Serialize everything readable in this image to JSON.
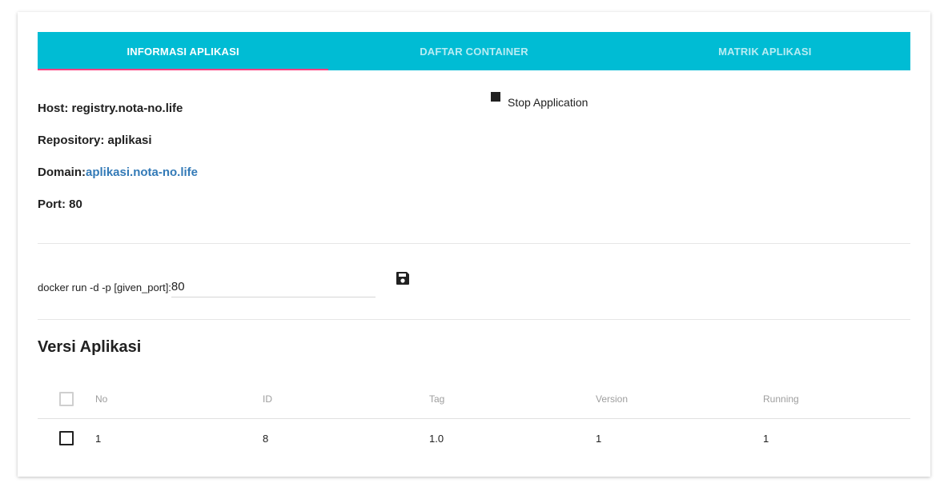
{
  "tabs": [
    {
      "label": "INFORMASI APLIKASI",
      "active": true
    },
    {
      "label": "DAFTAR CONTAINER",
      "active": false
    },
    {
      "label": "MATRIK APLIKASI",
      "active": false
    }
  ],
  "info": {
    "host": "Host: registry.nota-no.life",
    "repository": "Repository: aplikasi",
    "domain_label": "Domain:",
    "domain_link": "aplikasi.nota-no.life",
    "port": "Port: 80"
  },
  "actions": {
    "stop_label": "Stop Application"
  },
  "command": {
    "label": "docker run -d -p [given_port]:",
    "value": "80",
    "save_icon": "floppy-disk-icon"
  },
  "versions": {
    "title": "Versi Aplikasi",
    "columns": [
      "No",
      "ID",
      "Tag",
      "Version",
      "Running"
    ],
    "rows": [
      [
        "1",
        "8",
        "1.0",
        "1",
        "1"
      ]
    ]
  },
  "colors": {
    "tab_bar": "#00bcd4",
    "tab_indicator": "#ff4081",
    "link": "#337ab7"
  }
}
